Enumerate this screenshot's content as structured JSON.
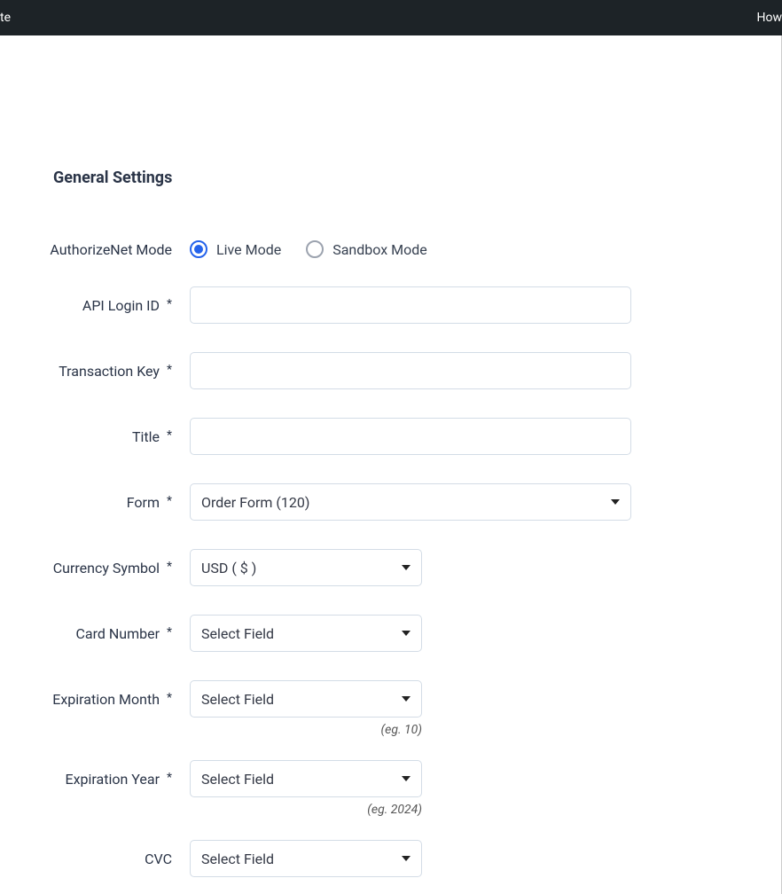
{
  "topbar": {
    "left_fragment": "te",
    "right_fragment": "How"
  },
  "section_title": "General Settings",
  "fields": {
    "mode": {
      "label": "AuthorizeNet Mode",
      "options": [
        {
          "label": "Live Mode",
          "selected": true
        },
        {
          "label": "Sandbox Mode",
          "selected": false
        }
      ]
    },
    "api_login": {
      "label": "API Login ID",
      "required": "*",
      "value": ""
    },
    "transaction_key": {
      "label": "Transaction Key",
      "required": "*",
      "value": ""
    },
    "title": {
      "label": "Title",
      "required": "*",
      "value": ""
    },
    "form": {
      "label": "Form",
      "required": "*",
      "value": "Order Form (120)"
    },
    "currency": {
      "label": "Currency Symbol",
      "required": "*",
      "value": "USD ( $ )"
    },
    "card_number": {
      "label": "Card Number",
      "required": "*",
      "value": "Select Field"
    },
    "exp_month": {
      "label": "Expiration Month",
      "required": "*",
      "value": "Select Field",
      "hint": "(eg. 10)"
    },
    "exp_year": {
      "label": "Expiration Year",
      "required": "*",
      "value": "Select Field",
      "hint": "(eg. 2024)"
    },
    "cvc": {
      "label": "CVC",
      "value": "Select Field"
    }
  }
}
